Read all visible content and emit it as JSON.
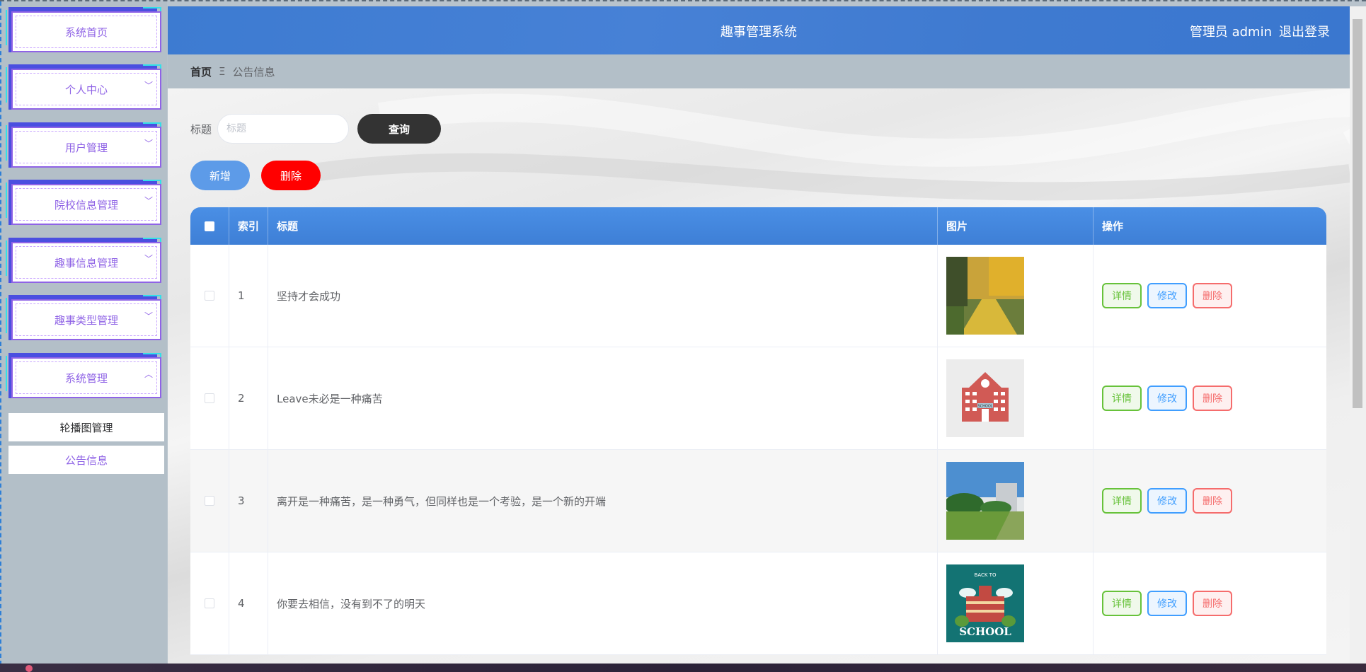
{
  "app_title": "趣事管理系统",
  "header": {
    "user_label": "管理员 admin",
    "logout_label": "退出登录"
  },
  "sidebar": {
    "items": [
      {
        "label": "系统首页",
        "chevron": ""
      },
      {
        "label": "个人中心",
        "chevron": "﹀"
      },
      {
        "label": "用户管理",
        "chevron": "﹀"
      },
      {
        "label": "院校信息管理",
        "chevron": "﹀"
      },
      {
        "label": "趣事信息管理",
        "chevron": "﹀"
      },
      {
        "label": "趣事类型管理",
        "chevron": "﹀"
      },
      {
        "label": "系统管理",
        "chevron": "︿"
      }
    ],
    "sub_items": [
      {
        "label": "轮播图管理",
        "color": "#303133"
      },
      {
        "label": "公告信息",
        "color": "#8f63e6"
      }
    ]
  },
  "breadcrumb": {
    "home": "首页",
    "separator": "Ξ",
    "current": "公告信息"
  },
  "search": {
    "label": "标题",
    "placeholder": "标题",
    "value": "",
    "query_button": "查询"
  },
  "actions": {
    "add_button": "新增",
    "delete_button": "删除"
  },
  "table": {
    "columns": [
      "索引",
      "标题",
      "图片",
      "操作"
    ],
    "rows": [
      {
        "index": "1",
        "title": "坚持才会成功",
        "image": "autumn-path"
      },
      {
        "index": "2",
        "title": "Leave未必是一种痛苦",
        "image": "school-building-icon"
      },
      {
        "index": "3",
        "title": "离开是一种痛苦，是一种勇气，但同样也是一个考验，是一个新的开端",
        "image": "campus-lawn"
      },
      {
        "index": "4",
        "title": "你要去相信，没有到不了的明天",
        "image": "back-to-school"
      }
    ],
    "op_labels": {
      "detail": "详情",
      "edit": "修改",
      "remove": "删除"
    }
  },
  "colors": {
    "header_blue": "#3f7bd1",
    "menu_purple": "#8f63e6",
    "delete_red": "#ff0000",
    "add_blue": "#5d9be8",
    "query_dark": "#333333"
  },
  "thumb_text": {
    "back_to_school_line1": "BACK TO",
    "back_to_school_line2": "SCHOOL",
    "school_sign": "SCHOOL"
  }
}
